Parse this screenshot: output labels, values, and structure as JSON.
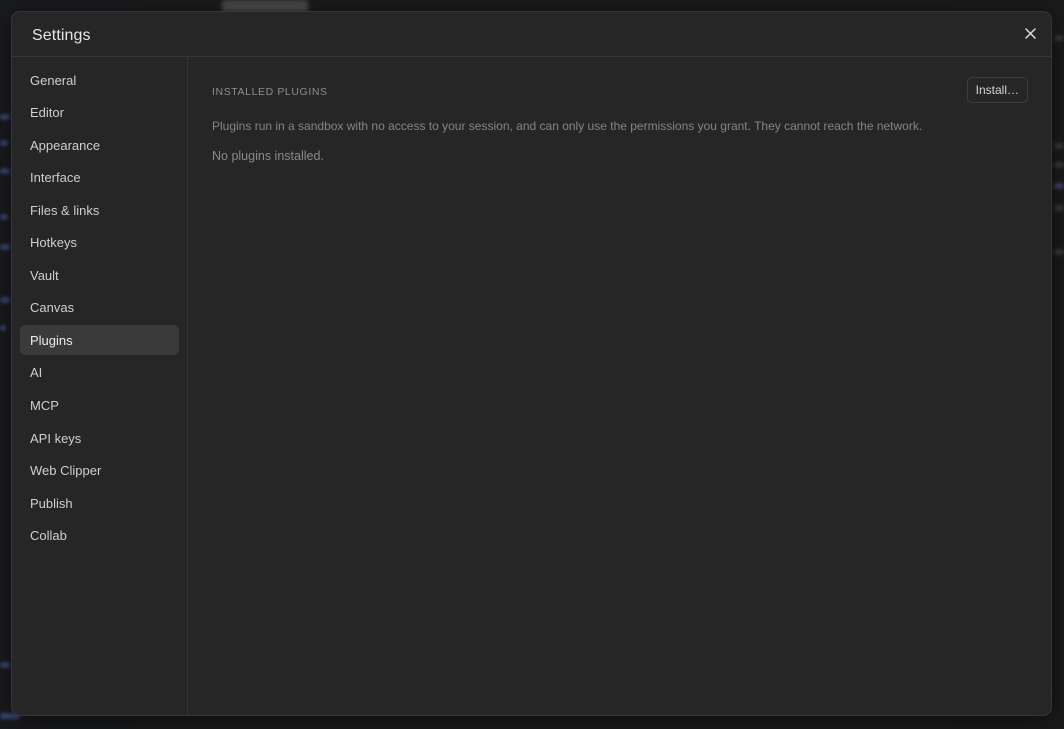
{
  "settings": {
    "title": "Settings",
    "close_icon": "close-icon",
    "nav": [
      {
        "label": "General"
      },
      {
        "label": "Editor"
      },
      {
        "label": "Appearance"
      },
      {
        "label": "Interface"
      },
      {
        "label": "Files & links"
      },
      {
        "label": "Hotkeys"
      },
      {
        "label": "Vault"
      },
      {
        "label": "Canvas"
      },
      {
        "label": "Plugins",
        "active": true
      },
      {
        "label": "AI"
      },
      {
        "label": "MCP"
      },
      {
        "label": "API keys"
      },
      {
        "label": "Web Clipper"
      },
      {
        "label": "Publish"
      },
      {
        "label": "Collab"
      }
    ],
    "plugins": {
      "section_title": "INSTALLED PLUGINS",
      "install_label": "Install…",
      "description": "Plugins run in a sandbox with no access to your session, and can only use the permissions you grant. They cannot reach the network.",
      "empty_text": "No plugins installed."
    }
  },
  "colors": {
    "modal_bg": "#262626",
    "active_nav_bg": "#3a3a3a",
    "text": "#e6e6e6",
    "muted_text": "#858585"
  }
}
